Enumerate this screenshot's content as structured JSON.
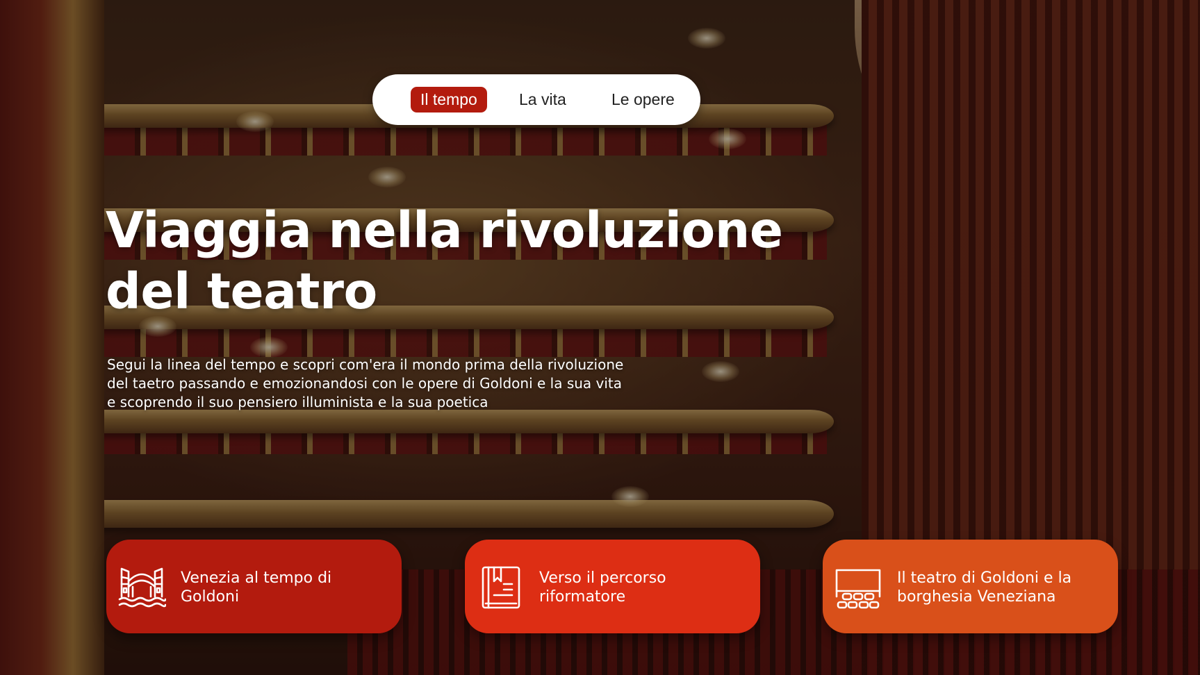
{
  "nav": {
    "items": [
      {
        "label": "Il tempo",
        "active": true
      },
      {
        "label": "La vita",
        "active": false
      },
      {
        "label": "Le opere",
        "active": false
      }
    ]
  },
  "hero": {
    "headline_line1": "Viaggia nella rivoluzione",
    "headline_line2": "del teatro",
    "intro_line1": "Segui la linea del tempo e scopri com'era il mondo prima della rivoluzione",
    "intro_line2": "del taetro passando e emozionandosi con le opere di Goldoni e la sua vita",
    "intro_line3": "e scoprendo il suo pensiero illuminista e la sua poetica"
  },
  "cards": [
    {
      "icon": "venice-bridge-icon",
      "line1": "Venezia al tempo di",
      "line2": "Goldoni",
      "color": "#b31b0e"
    },
    {
      "icon": "open-book-icon",
      "line1": "Verso il percorso",
      "line2": "riformatore",
      "color": "#dd2e14"
    },
    {
      "icon": "theatre-stage-icon",
      "line1": "Il teatro di Goldoni e la",
      "line2": "borghesia Veneziana",
      "color": "#d9501a"
    }
  ],
  "colors": {
    "accent_dark": "#b31b0e",
    "accent_red": "#dd2e14",
    "accent_orange": "#d9501a"
  }
}
